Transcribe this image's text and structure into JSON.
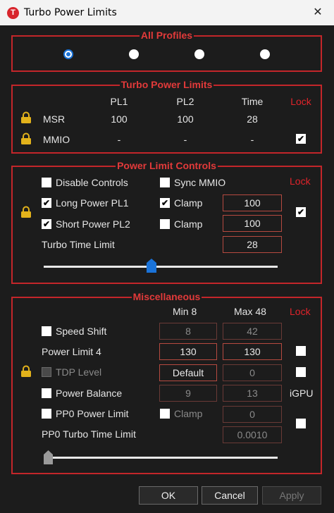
{
  "window": {
    "title": "Turbo Power Limits",
    "icon_letter": "T",
    "close_glyph": "✕"
  },
  "groups": {
    "all_profiles": "All Profiles",
    "turbo_power_limits": "Turbo Power Limits",
    "power_limit_controls": "Power Limit Controls",
    "miscellaneous": "Miscellaneous"
  },
  "profiles": {
    "selected_index": 0,
    "count": 4
  },
  "tpl": {
    "headers": {
      "pl1": "PL1",
      "pl2": "PL2",
      "time": "Time",
      "lock": "Lock"
    },
    "rows": [
      {
        "label": "MSR",
        "pl1": "100",
        "pl2": "100",
        "time": "28"
      },
      {
        "label": "MMIO",
        "pl1": "-",
        "pl2": "-",
        "time": "-"
      }
    ],
    "mmio_lock_checked": true
  },
  "plc": {
    "lock_label": "Lock",
    "disable_controls": "Disable Controls",
    "sync_mmio": "Sync MMIO",
    "long_power": "Long Power PL1",
    "short_power": "Short Power PL2",
    "clamp": "Clamp",
    "pl1_value": "100",
    "pl2_value": "100",
    "turbo_time_label": "Turbo Time Limit",
    "turbo_time_value": "28",
    "slider_position": 0.46,
    "checked": {
      "disable_controls": false,
      "sync_mmio": false,
      "long_power": true,
      "long_clamp": true,
      "short_power": true,
      "short_clamp": false,
      "lock": true
    }
  },
  "misc": {
    "min_label": "Min  8",
    "max_label": "Max  48",
    "lock_label": "Lock",
    "speed_shift": "Speed Shift",
    "speed_min": "8",
    "speed_max": "42",
    "power_limit_4": "Power Limit 4",
    "pl4_min": "130",
    "pl4_max": "130",
    "tdp_level": "TDP Level",
    "tdp_value": "Default",
    "tdp_max": "0",
    "power_balance": "Power Balance",
    "pb_min": "9",
    "pb_max": "13",
    "igpu": "iGPU",
    "pp0_power_limit": "PP0 Power Limit",
    "clamp": "Clamp",
    "pp0_value": "0",
    "pp0_turbo_time": "PP0 Turbo Time Limit",
    "pp0_turbo_value": "0.0010",
    "slider_position": 0.0
  },
  "buttons": {
    "ok": "OK",
    "cancel": "Cancel",
    "apply": "Apply"
  },
  "colors": {
    "accent_red": "#c3262a",
    "radio_blue": "#1a73d9",
    "lock_gold": "#e2b21b"
  },
  "icons": {
    "lock": "lock-icon",
    "check": "✔"
  }
}
